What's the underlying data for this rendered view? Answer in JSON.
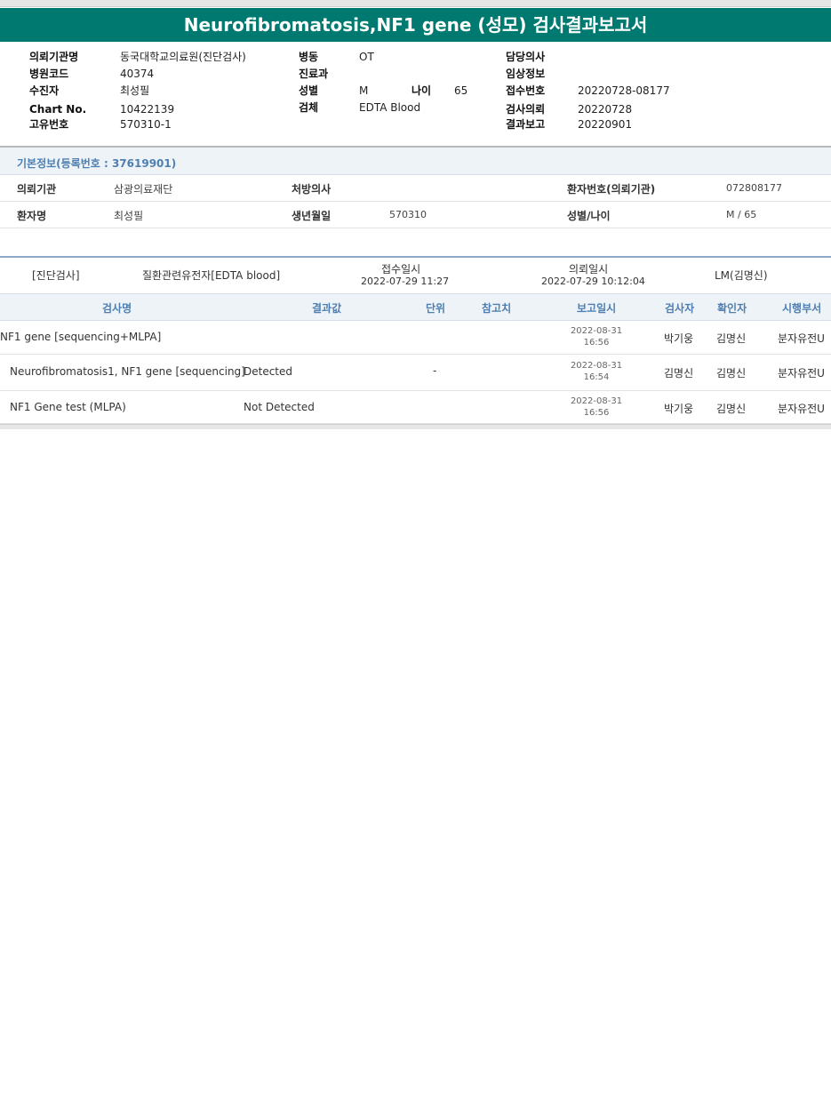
{
  "title": "Neurofibromatosis,NF1 gene (성모) 검사결과보고서",
  "header": {
    "hospital_label": "의뢰기관명",
    "hospital_value": "동국대학교의료원(진단검사)",
    "code_label": "병원코드",
    "code_value": "40374",
    "examinee_label": "수진자",
    "examinee_value": "최성필",
    "chart_label": "Chart No.",
    "chart_value": "10422139",
    "uid_label": "고유번호",
    "uid_value": "570310-1",
    "ward_label": "병동",
    "ward_value": "OT",
    "dept_label": "진료과",
    "dept_value": "",
    "sex_label": "성별",
    "sex_value": "M",
    "age_label": "나이",
    "age_value": "65",
    "specimen_label": "검체",
    "specimen_value": "EDTA Blood",
    "doctor_label": "담당의사",
    "doctor_value": "",
    "clinical_label": "임상정보",
    "clinical_value": "",
    "receipt_label": "접수번호",
    "receipt_value": "20220728-08177",
    "request_label": "검사의뢰",
    "request_value": "20220728",
    "report_label": "결과보고",
    "report_value": "20220901"
  },
  "basic_info": {
    "title": "기본정보(등록번호 : 37619901)",
    "institution_label": "의뢰기관",
    "institution_value": "삼광의료재단",
    "prescriber_label": "처방의사",
    "prescriber_value": "",
    "patient_no_label": "환자번호(의뢰기관)",
    "patient_no_value": "072808177",
    "patient_label": "환자명",
    "patient_value": "최성필",
    "birth_label": "생년월일",
    "birth_value": "570310",
    "sexage_label": "성별/나이",
    "sexage_value": "M / 65"
  },
  "order": {
    "category": "[진단검사]",
    "group": "질환관련유전자[EDTA blood]",
    "received_label": "접수일시",
    "received_value": "2022-07-29  11:27",
    "requested_label": "의뢰일시",
    "requested_value": "2022-07-29  10:12:04",
    "lm": "LM(김명신)"
  },
  "table": {
    "headers": [
      "검사명",
      "결과값",
      "단위",
      "참고치",
      "보고일시",
      "검사자",
      "확인자",
      "시행부서"
    ],
    "rows": [
      {
        "name": "NF1 gene [sequencing+MLPA]",
        "result": "",
        "unit": "",
        "ref": "",
        "date": "2022-08-31",
        "time": "16:56",
        "tester": "박기웅",
        "confirmer": "김명신",
        "dept": "분자유전U"
      },
      {
        "name": "Neurofibromatosis1, NF1 gene [sequencing]",
        "result": "Detected",
        "unit": "-",
        "ref": "",
        "date": "2022-08-31",
        "time": "16:54",
        "tester": "김명신",
        "confirmer": "김명신",
        "dept": "분자유전U"
      },
      {
        "name": "NF1 Gene test (MLPA)",
        "result": "Not Detected",
        "unit": "",
        "ref": "",
        "date": "2022-08-31",
        "time": "16:56",
        "tester": "박기웅",
        "confirmer": "김명신",
        "dept": "분자유전U"
      }
    ]
  },
  "colors": {
    "title_bar": "#007a70",
    "section_text": "#4f7fb0",
    "section_bg": "#eef3f7"
  }
}
